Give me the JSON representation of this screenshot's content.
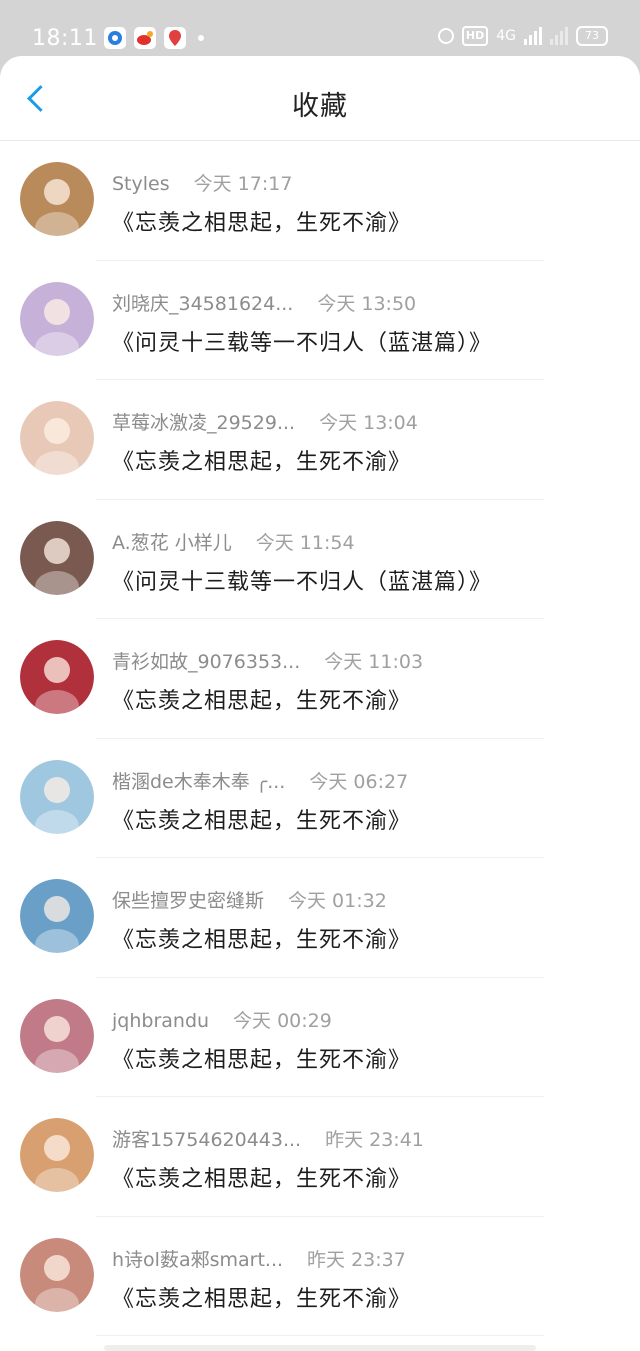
{
  "status_bar": {
    "time": "18:11",
    "battery": "73",
    "network": "4G",
    "hd": "HD"
  },
  "header": {
    "title": "收藏",
    "back_icon": "chevron-left-icon",
    "accent_color": "#1a9be8"
  },
  "items": [
    {
      "user": "Styles",
      "time": "今天 17:17",
      "title": "《忘羡之相思起，生死不渝》",
      "avatar_color": "#b98a5a"
    },
    {
      "user": "刘晓庆_34581624...",
      "time": "今天 13:50",
      "title": "《问灵十三载等一不归人（蓝湛篇）》",
      "avatar_color": "#c6b2d8"
    },
    {
      "user": "草莓冰激凌_29529...",
      "time": "今天 13:04",
      "title": "《忘羡之相思起，生死不渝》",
      "avatar_color": "#e8c9b8"
    },
    {
      "user": "A.葱花 小样儿",
      "time": "今天 11:54",
      "title": "《问灵十三载等一不归人（蓝湛篇）》",
      "avatar_color": "#7a5a50"
    },
    {
      "user": "青衫如故_9076353...",
      "time": "今天 11:03",
      "title": "《忘羡之相思起，生死不渝》",
      "avatar_color": "#b0303c"
    },
    {
      "user": "楷溷de木奉木奉 ╭...",
      "time": "今天 06:27",
      "title": "《忘羡之相思起，生死不渝》",
      "avatar_color": "#9fc7e0"
    },
    {
      "user": "保些擅罗史密缝斯",
      "time": "今天 01:32",
      "title": "《忘羡之相思起，生死不渝》",
      "avatar_color": "#6aa0c8"
    },
    {
      "user": "jqhbrandu",
      "time": "今天 00:29",
      "title": "《忘羡之相思起，生死不渝》",
      "avatar_color": "#c07a88"
    },
    {
      "user": "游客15754620443...",
      "time": "昨天 23:41",
      "title": "《忘羡之相思起，生死不渝》",
      "avatar_color": "#d8a070"
    },
    {
      "user": "h诗ol薮a郲smart...",
      "time": "昨天 23:37",
      "title": "《忘羡之相思起，生死不渝》",
      "avatar_color": "#c88a7a"
    }
  ]
}
